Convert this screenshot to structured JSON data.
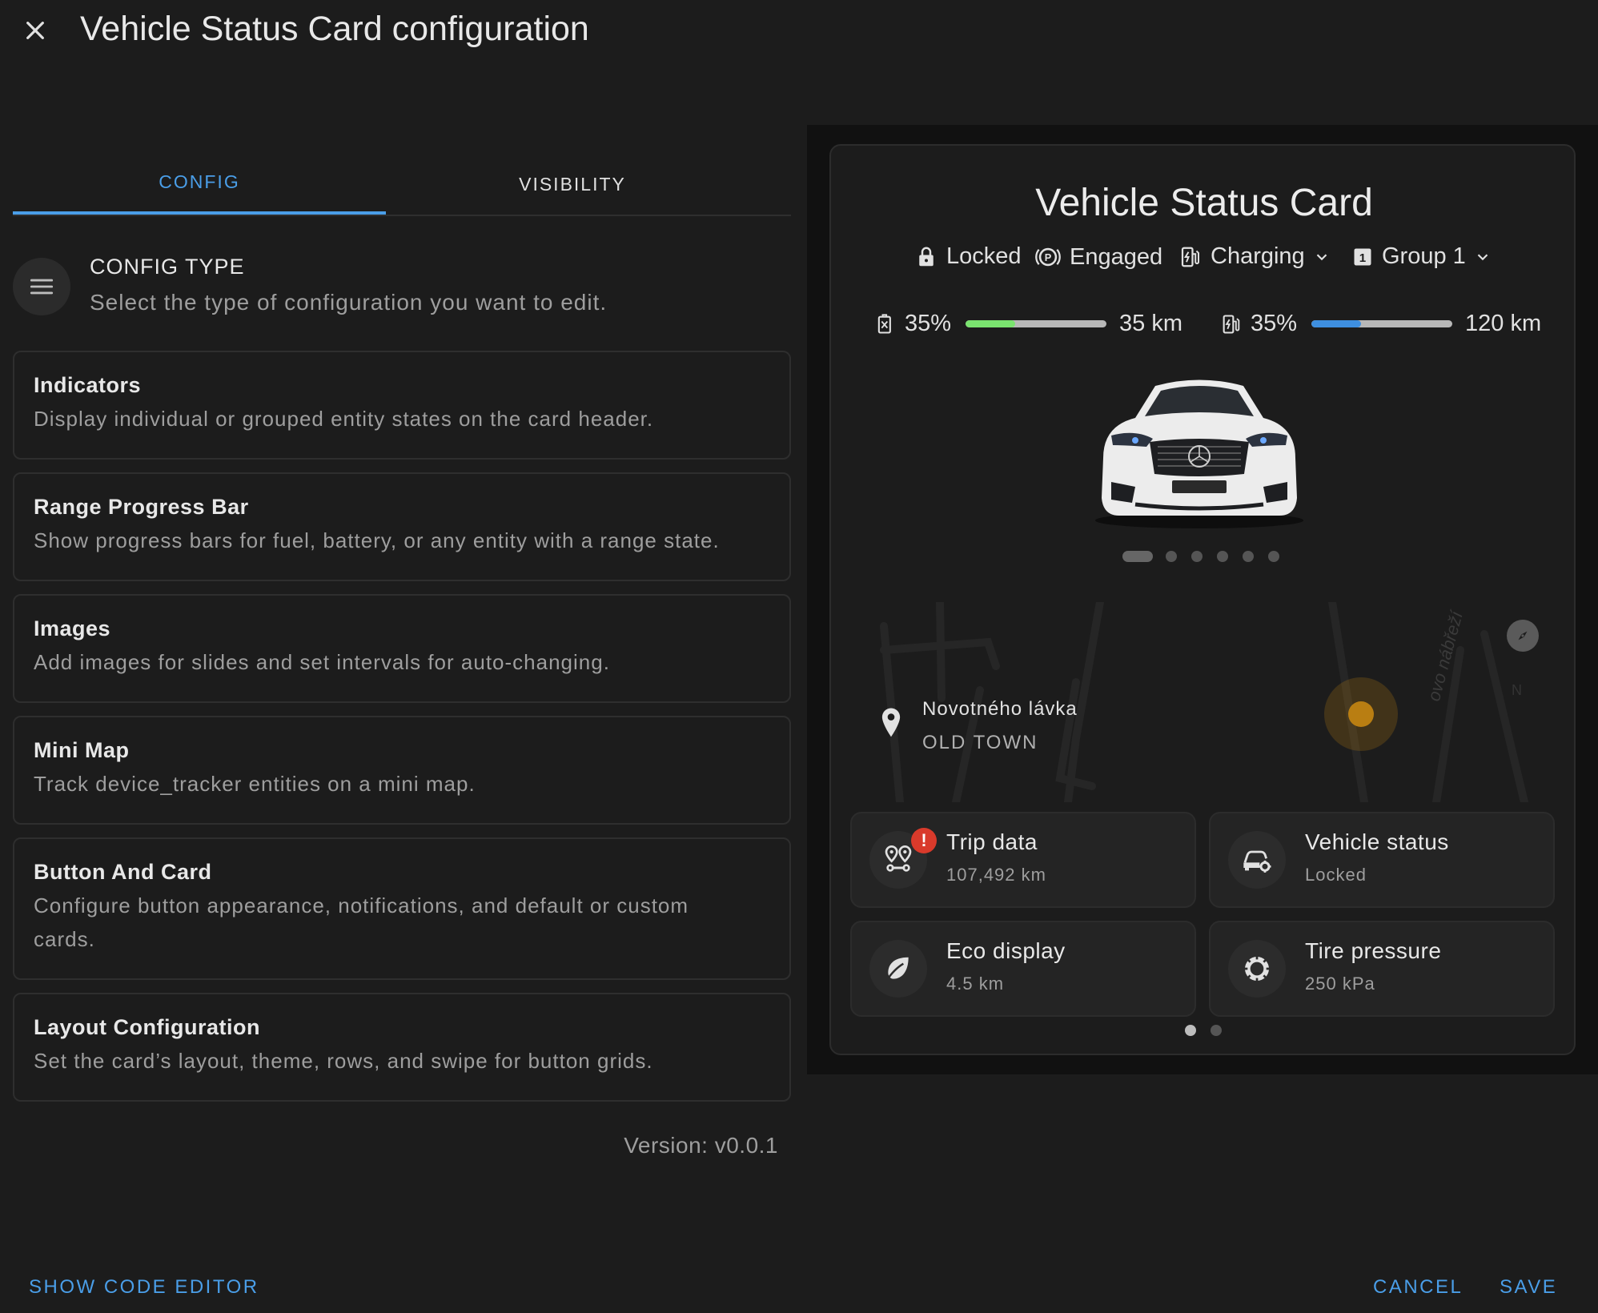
{
  "dialog": {
    "title": "Vehicle Status Card configuration",
    "close_icon": "close-icon"
  },
  "tabs": [
    {
      "label": "CONFIG",
      "active": true
    },
    {
      "label": "VISIBILITY",
      "active": false
    }
  ],
  "config_type": {
    "icon": "menu-icon",
    "title": "CONFIG TYPE",
    "description": "Select the type of configuration you want to edit."
  },
  "menu": [
    {
      "title": "Indicators",
      "description": "Display individual or grouped entity states on the card header."
    },
    {
      "title": "Range Progress Bar",
      "description": "Show progress bars for fuel, battery, or any entity with a range state."
    },
    {
      "title": "Images",
      "description": "Add images for slides and set intervals for auto-changing."
    },
    {
      "title": "Mini Map",
      "description": "Track device_tracker entities on a mini map."
    },
    {
      "title": "Button And Card",
      "description": "Configure button appearance, notifications, and default or custom cards."
    },
    {
      "title": "Layout Configuration",
      "description": "Set the card’s layout, theme, rows, and swipe for button grids."
    }
  ],
  "version": "Version: v0.0.1",
  "footer": {
    "show_code": "SHOW CODE EDITOR",
    "cancel": "CANCEL",
    "save": "SAVE"
  },
  "preview": {
    "title": "Vehicle Status Card",
    "indicators": [
      {
        "icon": "lock-icon",
        "label": "Locked"
      },
      {
        "icon": "parking-brake-icon",
        "label": "Engaged"
      },
      {
        "icon": "ev-station-icon",
        "label": "Charging",
        "has_dropdown": true
      },
      {
        "icon": "numeric-1-box-icon",
        "label": "Group 1",
        "has_dropdown": true
      }
    ],
    "ranges": [
      {
        "icon": "fuel-icon",
        "percent": "35%",
        "level": 0.35,
        "range": "35 km",
        "color": "#7ae36f"
      },
      {
        "icon": "ev-station-icon",
        "percent": "35%",
        "level": 0.35,
        "range": "120 km",
        "color": "#3e8fe0"
      }
    ],
    "image_slides": {
      "count": 6,
      "active_index": 0
    },
    "map": {
      "street": "Novotného lávka",
      "area": "OLD TOWN",
      "road_label": "ovo nábřeží",
      "corner_label": "N",
      "marker_color": "#c98a12"
    },
    "buttons": [
      {
        "icon": "map-marker-distance-icon",
        "title": "Trip data",
        "subtitle": "107,492 km",
        "badge": "!",
        "badge_color": "#d93a2b"
      },
      {
        "icon": "car-cog-icon",
        "title": "Vehicle status",
        "subtitle": "Locked"
      },
      {
        "icon": "leaf-icon",
        "title": "Eco display",
        "subtitle": "4.5 km"
      },
      {
        "icon": "tire-icon",
        "title": "Tire pressure",
        "subtitle": "250 kPa"
      }
    ],
    "button_pages": {
      "count": 2,
      "active_index": 0
    }
  },
  "colors": {
    "accent": "#4a9ee8",
    "background": "#1c1c1c",
    "card_border": "#2e2e2e"
  }
}
